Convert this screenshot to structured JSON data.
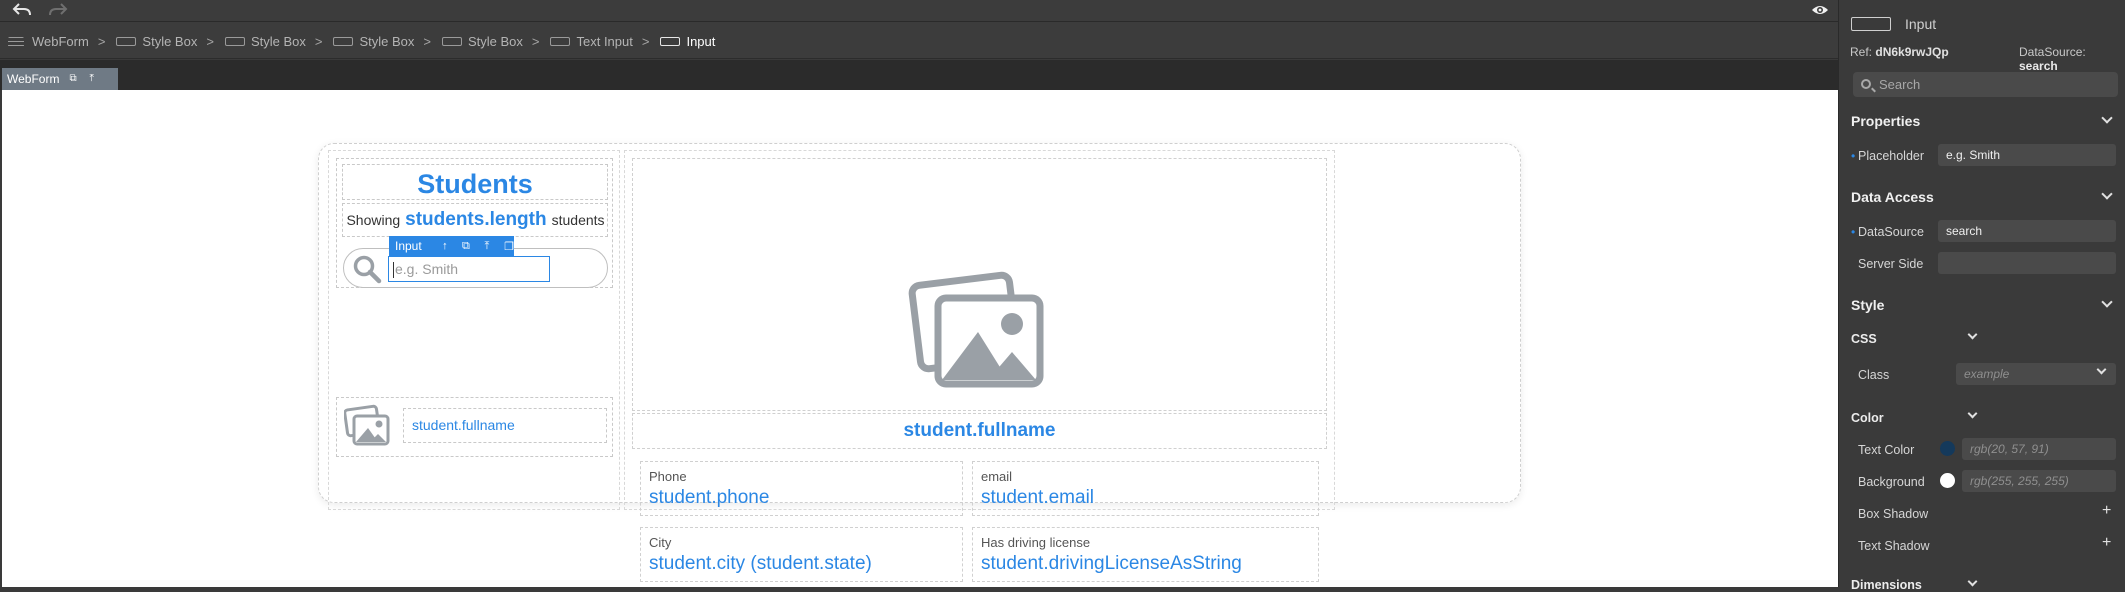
{
  "breadcrumb": [
    {
      "label": "WebForm"
    },
    {
      "label": "Style Box"
    },
    {
      "label": "Style Box"
    },
    {
      "label": "Style Box"
    },
    {
      "label": "Style Box"
    },
    {
      "label": "Text Input"
    },
    {
      "label": "Input"
    }
  ],
  "breadcrumb_separator": ">",
  "tab": {
    "label": "WebForm"
  },
  "form": {
    "title": "Students",
    "showing_prefix": "Showing",
    "showing_value": "students.length",
    "showing_suffix": "students",
    "search_placeholder": "e.g. Smith",
    "selection_label": "Input",
    "list_item_name": "student.fullname",
    "detail_fullname": "student.fullname",
    "fields": [
      {
        "label": "Phone",
        "value": "student.phone"
      },
      {
        "label": "email",
        "value": "student.email"
      },
      {
        "label": "City",
        "value": "student.city (student.state)"
      },
      {
        "label": "Has driving license",
        "value": "student.drivingLicenseAsString"
      }
    ]
  },
  "panel": {
    "component": "Input",
    "ref_label": "Ref:",
    "ref_value": "dN6k9rwJQp",
    "datasource_label": "DataSource:",
    "datasource_value": "search",
    "search_placeholder": "Search",
    "properties": {
      "title": "Properties",
      "placeholder_label": "Placeholder",
      "placeholder_value": "e.g. Smith"
    },
    "data_access": {
      "title": "Data Access",
      "datasource_label": "DataSource",
      "datasource_value": "search",
      "server_side_label": "Server Side",
      "server_side_value": ""
    },
    "style": {
      "title": "Style",
      "css_title": "CSS",
      "class_label": "Class",
      "class_placeholder": "example",
      "color_title": "Color",
      "text_color_label": "Text Color",
      "text_color_value": "rgb(20, 57, 91)",
      "text_color_swatch": "#14395b",
      "background_label": "Background",
      "background_value": "rgb(255, 255, 255)",
      "background_swatch": "#ffffff",
      "box_shadow_label": "Box Shadow",
      "text_shadow_label": "Text Shadow",
      "dimensions_title": "Dimensions"
    }
  },
  "colors": {
    "accent": "#2b87e4",
    "panel_bg": "#3a3a3a"
  },
  "icons": [
    "undo-icon",
    "redo-icon",
    "eye-icon",
    "hamburger-icon",
    "box-icon",
    "image-placeholder-icon",
    "search-icon",
    "chevron-down-icon",
    "plus-icon"
  ]
}
